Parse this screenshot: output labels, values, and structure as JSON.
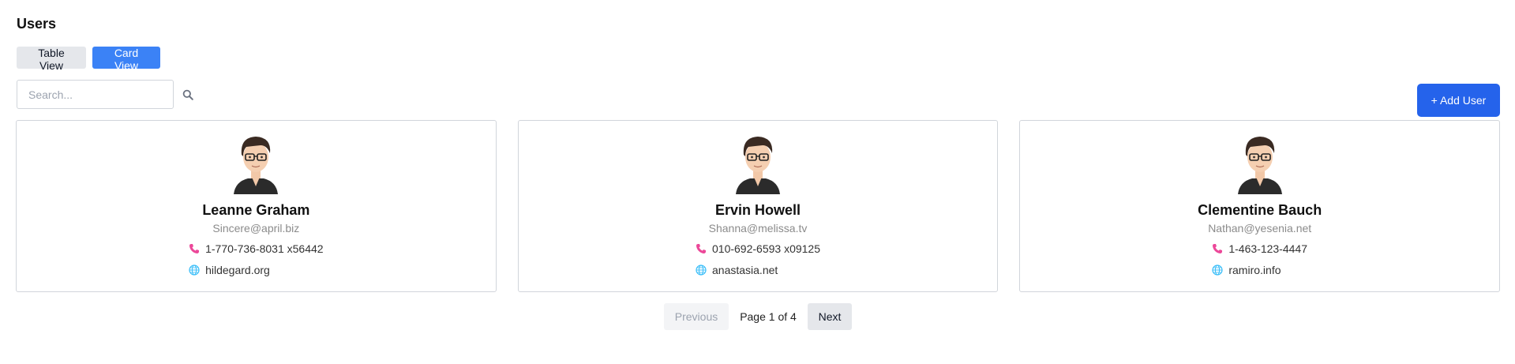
{
  "page": {
    "title": "Users"
  },
  "view_toggle": {
    "table_label": "Table View",
    "card_label": "Card View",
    "active": "Card View"
  },
  "search": {
    "placeholder": "Search...",
    "value": ""
  },
  "add_user": {
    "label": "+ Add User"
  },
  "users": [
    {
      "name": "Leanne Graham",
      "email": "Sincere@april.biz",
      "phone": "1-770-736-8031 x56442",
      "website": "hildegard.org"
    },
    {
      "name": "Ervin Howell",
      "email": "Shanna@melissa.tv",
      "phone": "010-692-6593 x09125",
      "website": "anastasia.net"
    },
    {
      "name": "Clementine Bauch",
      "email": "Nathan@yesenia.net",
      "phone": "1-463-123-4447",
      "website": "ramiro.info"
    }
  ],
  "pagination": {
    "previous_label": "Previous",
    "page_label": "Page 1 of 4",
    "next_label": "Next",
    "current_page": 1,
    "total_pages": 4
  },
  "colors": {
    "accent": "#3b82f6",
    "primary_button": "#2563eb",
    "phone_icon": "#ec4899",
    "globe_icon": "#38bdf8"
  },
  "icons": {
    "search": "search-icon",
    "phone": "phone-icon",
    "website": "globe-icon",
    "avatar": "avatar-icon"
  }
}
